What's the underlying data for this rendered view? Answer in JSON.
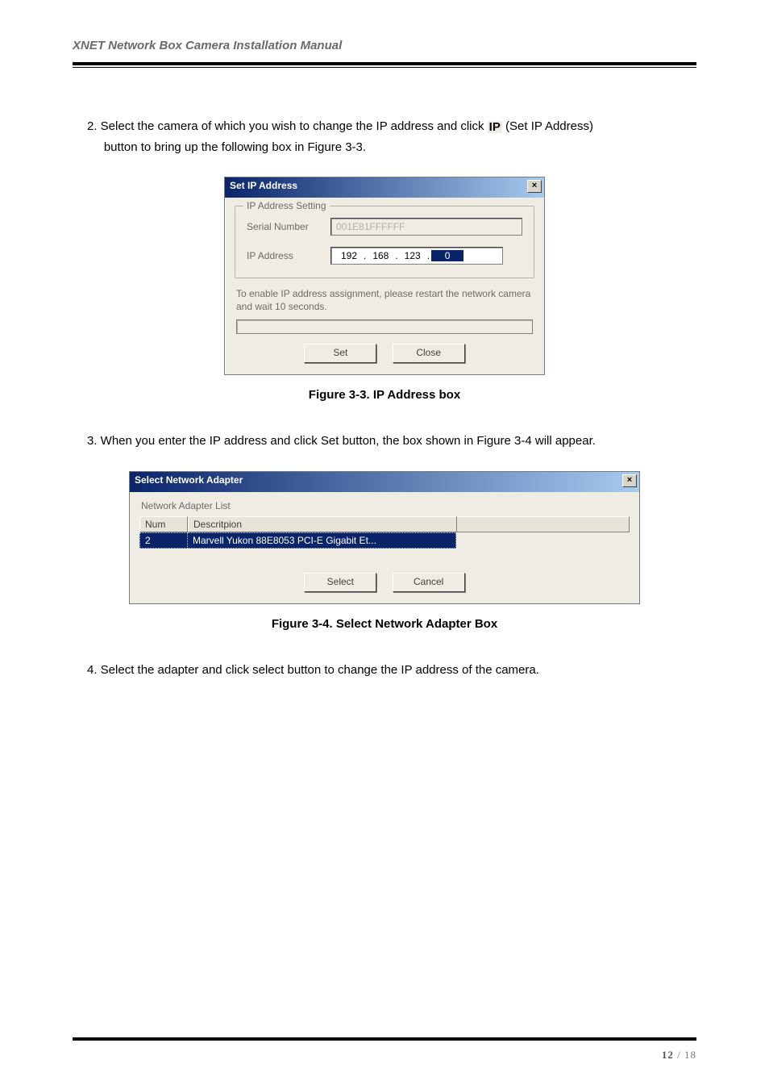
{
  "header": {
    "title": "XNET Network Box Camera Installation Manual"
  },
  "step2": {
    "prefix": "2. Select the camera of which you wish to change the IP address and click ",
    "ip_label": "IP",
    "suffix1": "(Set IP Address)",
    "line2": "button to bring up the following box in Figure 3-3."
  },
  "dlg1": {
    "title": "Set IP Address",
    "legend": "IP Address Setting",
    "serial_label": "Serial Number",
    "serial_value": "001E81FFFFFF",
    "ip_label": "IP Address",
    "ip_octets": [
      "192",
      "168",
      "123",
      "0"
    ],
    "note": "To enable IP address assignment, please restart the network camera and wait  10 seconds.",
    "set_btn": "Set",
    "close_btn": "Close"
  },
  "caption1": "Figure 3-3. IP Address box",
  "step3": "3. When you enter the IP address and click Set button, the box shown in Figure 3-4 will appear.",
  "dlg2": {
    "title": "Select Network Adapter",
    "list_label": "Network Adapter List",
    "col_num": "Num",
    "col_desc": "Descritpion",
    "row_num": "2",
    "row_desc": "Marvell Yukon 88E8053 PCI-E Gigabit Et...",
    "select_btn": "Select",
    "cancel_btn": "Cancel"
  },
  "caption2": "Figure 3-4. Select Network Adapter Box",
  "step4": "4. Select the adapter and click select button to change the IP address of the camera.",
  "footer": {
    "page_cur": "12",
    "page_sep": " / ",
    "page_total": "18"
  }
}
